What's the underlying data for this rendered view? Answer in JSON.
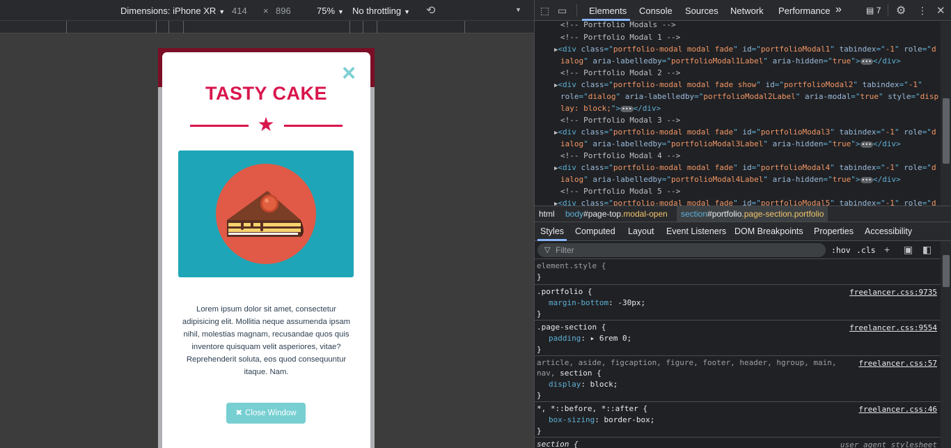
{
  "device_toolbar": {
    "dimensions_label": "Dimensions: iPhone XR",
    "width": "414",
    "times": "×",
    "height": "896",
    "zoom": "75%",
    "throttling": "No throttling"
  },
  "modal": {
    "title": "TASTY CAKE",
    "close_icon": "×",
    "star_icon": "★",
    "body_text": "Lorem ipsum dolor sit amet, consectetur adipisicing elit. Mollitia neque assumenda ipsam nihil, molestias magnam, recusandae quos quis inventore quisquam velit asperiores, vitae? Reprehenderit soluta, eos quod consequuntur itaque. Nam.",
    "close_button_icon": "✖",
    "close_button_label": "Close Window"
  },
  "devtools": {
    "tabs": [
      "Elements",
      "Console",
      "Sources",
      "Network",
      "Performance"
    ],
    "more_tabs": "»",
    "issues_count": "7",
    "dom_lines": [
      {
        "type": "comment",
        "text": "<!-- Portfolio Modals -->"
      },
      {
        "type": "comment",
        "text": "<!-- Portfolio Modal 1 -->"
      },
      {
        "type": "el",
        "line1": [
          "<div ",
          "class",
          "=\"",
          "portfolio-modal modal fade",
          "\" ",
          "id",
          "=\"",
          "portfolioModal1",
          "\" ",
          "tabindex",
          "=\"",
          "-1",
          "\" ",
          "role",
          "=\"",
          "d"
        ],
        "line2": [
          "ialog",
          "\" ",
          "aria-labelledby",
          "=\"",
          "portfolioModal1Label",
          "\" ",
          "aria-hidden",
          "=\"",
          "true",
          "\">"
        ]
      },
      {
        "type": "comment",
        "text": "<!-- Portfolio Modal 2 -->"
      },
      {
        "type": "el2"
      },
      {
        "type": "comment",
        "text": "<!-- Portfolio Modal 3 -->"
      },
      {
        "type": "comment",
        "text": "<!-- Portfolio Modal 4 -->"
      },
      {
        "type": "comment",
        "text": "<!-- Portfolio Modal 5 -->"
      }
    ],
    "breadcrumbs": {
      "html": "html",
      "body_tag": "body",
      "body_id": "#page-top",
      "body_class": ".modal-open",
      "section_tag": "section",
      "section_id": "#portfolio",
      "section_class": ".page-section.portfolio"
    },
    "styles_tabs": [
      "Styles",
      "Computed",
      "Layout",
      "Event Listeners",
      "DOM Breakpoints",
      "Properties",
      "Accessibility"
    ],
    "filter_placeholder": "Filter",
    "hov": ":hov",
    "cls": ".cls",
    "rules": [
      {
        "selector": "element.style {",
        "props": [],
        "source": ""
      },
      {
        "selector": ".portfolio {",
        "props": [
          {
            "name": "margin-bottom",
            "value": "-30px;"
          }
        ],
        "source": "freelancer.css:9735"
      },
      {
        "selector": ".page-section {",
        "props": [
          {
            "name": "padding",
            "value": "▸ 6rem 0;"
          }
        ],
        "source": "freelancer.css:9554"
      },
      {
        "selector_dim": "article, aside, figcaption, figure, footer, header, hgroup, main,",
        "selector_dim2": "nav, ",
        "selector_strong": "section",
        "selector_end": " {",
        "props": [
          {
            "name": "display",
            "value": "block;"
          }
        ],
        "source": "freelancer.css:57"
      },
      {
        "selector": "*, *::before, *::after {",
        "props": [
          {
            "name": "box-sizing",
            "value": "border-box;"
          }
        ],
        "source": "freelancer.css:46"
      },
      {
        "selector": "section {",
        "props": [],
        "source": "user agent stylesheet"
      }
    ]
  },
  "colors": {
    "accent_red": "#d8164c",
    "accent_teal": "#77cfd2",
    "image_bg": "#1ea5b7",
    "devtools_bg": "#202124"
  }
}
